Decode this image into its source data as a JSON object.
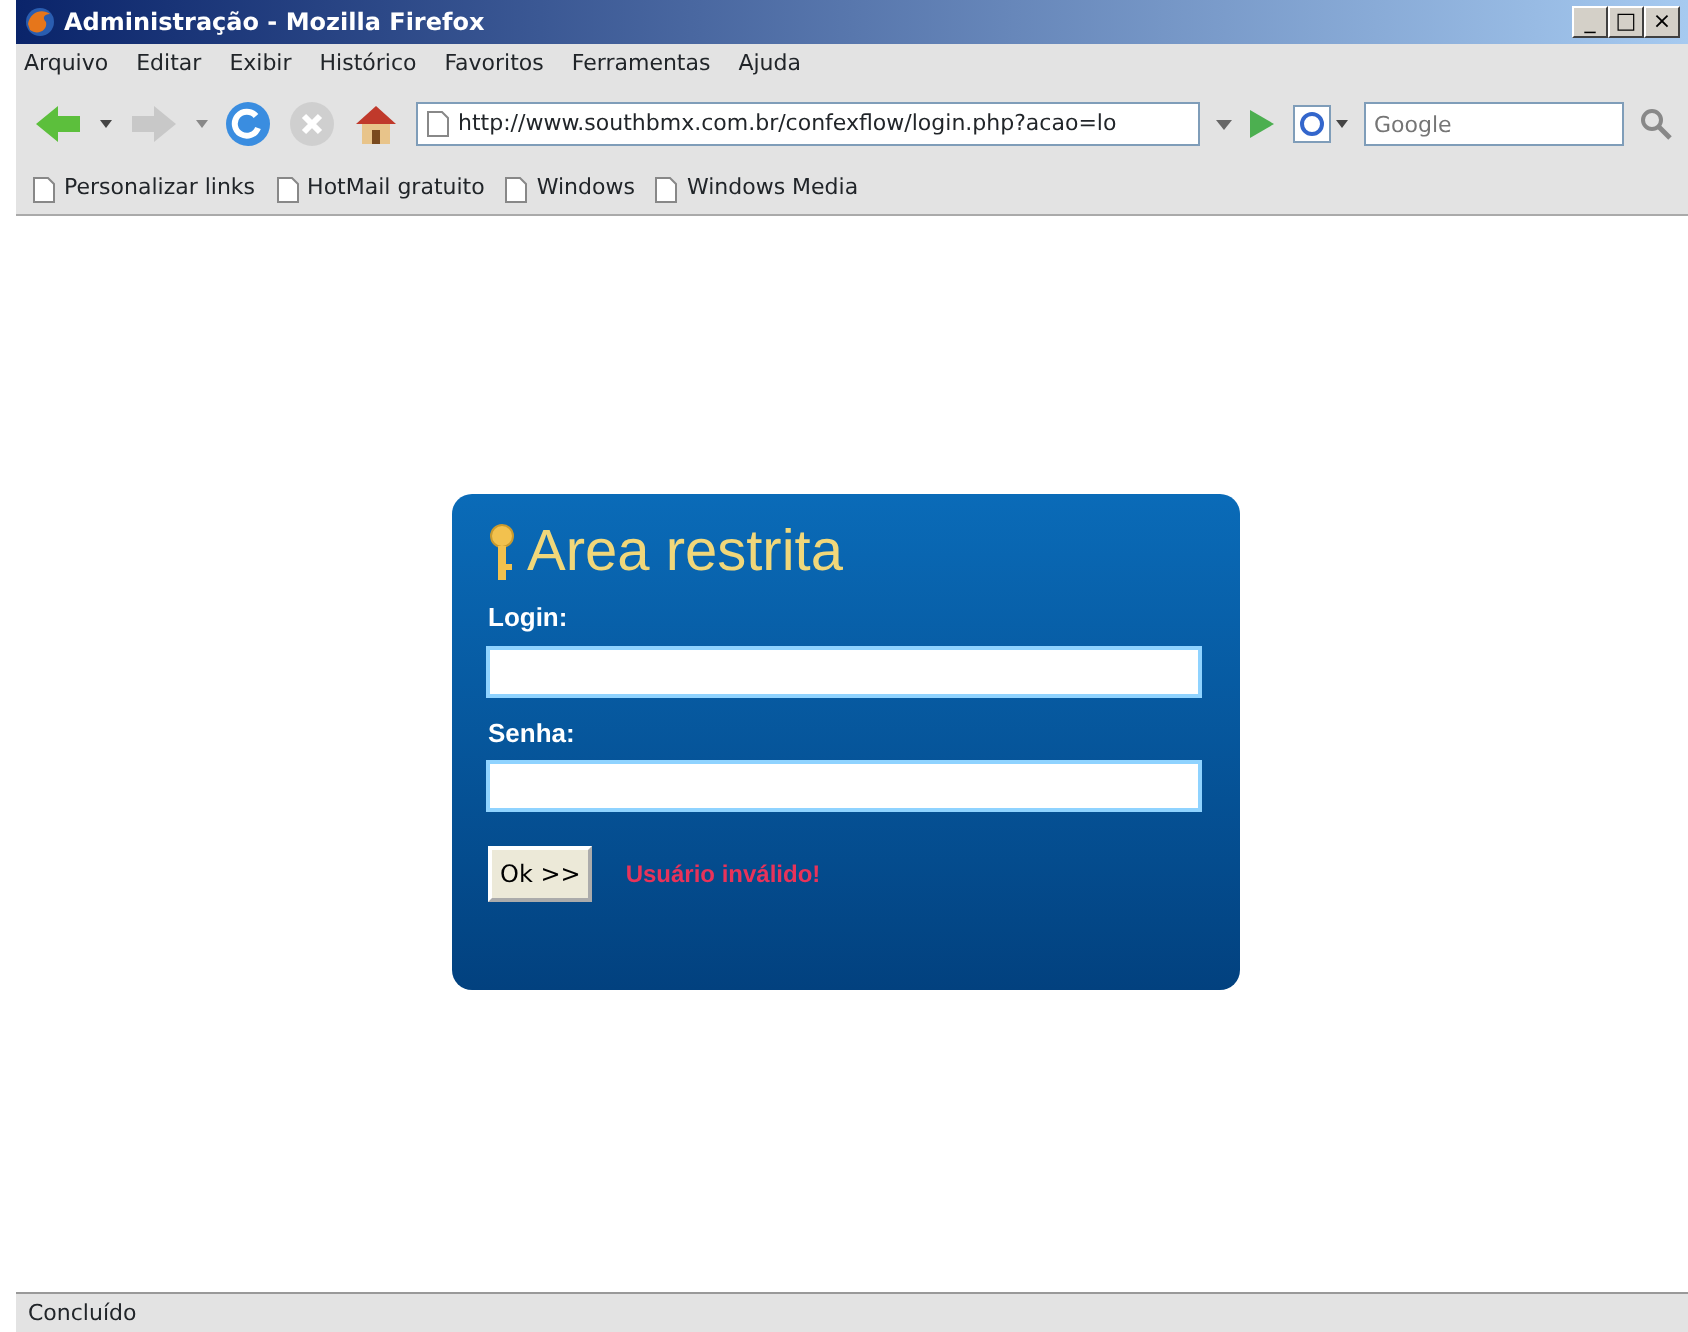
{
  "window": {
    "title": "Administração - Mozilla Firefox",
    "controls": [
      "_",
      "□",
      "×"
    ]
  },
  "menu": [
    "Arquivo",
    "Editar",
    "Exibir",
    "Histórico",
    "Favoritos",
    "Ferramentas",
    "Ajuda"
  ],
  "toolbar": {
    "address": "http://www.southbmx.com.br/confexflow/login.php?acao=lo",
    "search_placeholder": "Google"
  },
  "bookmarks": [
    "Personalizar links",
    "HotMail gratuito",
    "Windows",
    "Windows Media"
  ],
  "login": {
    "title": "Area restrita",
    "fields": [
      {
        "label": "Login:"
      },
      {
        "label": "Senha:"
      }
    ],
    "button": "Ok >>",
    "error": "Usuário inválido!"
  },
  "status_bar": "Concluído"
}
